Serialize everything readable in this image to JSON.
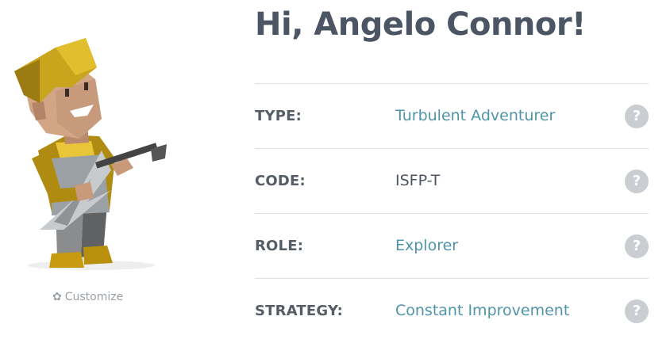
{
  "profile": {
    "greeting": "Hi, Angelo Connor!",
    "customize_label": "Customize",
    "customize_icon": "gear-icon"
  },
  "rows": [
    {
      "label": "TYPE:",
      "value": "Turbulent Adventurer",
      "style": "link",
      "help": "?"
    },
    {
      "label": "CODE:",
      "value": "ISFP-T",
      "style": "plain",
      "help": "?"
    },
    {
      "label": "ROLE:",
      "value": "Explorer",
      "style": "link",
      "help": "?"
    },
    {
      "label": "STRATEGY:",
      "value": "Constant Improvement",
      "style": "link",
      "help": "?"
    }
  ],
  "colors": {
    "link": "#4f94a8",
    "heading": "#4b5563",
    "help_bg": "#cacdd1",
    "divider": "#dde0e4"
  }
}
